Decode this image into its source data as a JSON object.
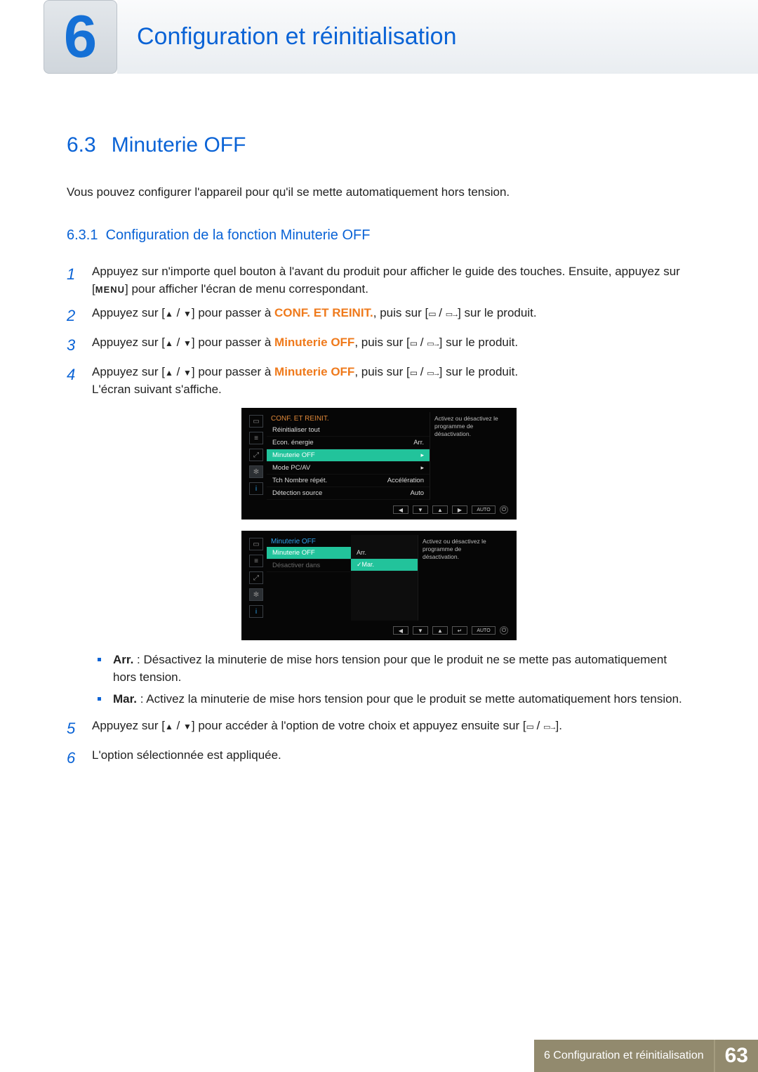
{
  "header": {
    "chapter_number": "6",
    "chapter_title": "Configuration et réinitialisation"
  },
  "section": {
    "number": "6.3",
    "title": "Minuterie OFF",
    "intro": "Vous pouvez configurer l'appareil pour qu'il se mette automatiquement hors tension."
  },
  "subsection": {
    "number": "6.3.1",
    "title": "Configuration de la fonction Minuterie OFF"
  },
  "steps": {
    "s1a": "Appuyez sur n'importe quel bouton à l'avant du produit pour afficher le guide des touches. Ensuite, appuyez sur [",
    "s1menu": "MENU",
    "s1b": "] pour afficher l'écran de menu correspondant.",
    "s2a": "Appuyez sur [",
    "s2b": "] pour passer à ",
    "s2hi": "CONF. ET REINIT.",
    "s2c": ", puis sur [",
    "s2d": "] sur le produit.",
    "s3a": "Appuyez sur [",
    "s3b": "] pour passer à ",
    "s3hi": "Minuterie OFF",
    "s3c": ", puis sur [",
    "s3d": "] sur le produit.",
    "s4a": "Appuyez sur [",
    "s4b": "] pour passer à ",
    "s4hi": "Minuterie OFF",
    "s4c": ", puis sur [",
    "s4d": "] sur le produit.",
    "s4e": "L'écran suivant s'affiche.",
    "s5a": "Appuyez sur [",
    "s5b": "] pour accéder à l'option de votre choix et appuyez ensuite sur [",
    "s5c": "].",
    "s6": "L'option sélectionnée est appliquée."
  },
  "osd1": {
    "title": "CONF. ET REINIT.",
    "rows": [
      {
        "label": "Réinitialiser tout",
        "value": ""
      },
      {
        "label": "Econ. énergie",
        "value": "Arr."
      },
      {
        "label": "Minuterie OFF",
        "value": "",
        "hi": true,
        "arrow": true
      },
      {
        "label": "Mode PC/AV",
        "value": "",
        "arrow": true
      },
      {
        "label": "Tch Nombre répét.",
        "value": "Accélération"
      },
      {
        "label": "Détection source",
        "value": "Auto"
      }
    ],
    "side": "Activez ou désactivez le programme de désactivation.",
    "nav_auto": "AUTO"
  },
  "osd2": {
    "title": "Minuterie OFF",
    "rows": [
      {
        "label": "Minuterie OFF",
        "hi": true
      },
      {
        "label": "Désactiver dans",
        "dim": true
      }
    ],
    "sub": [
      {
        "label": "Arr."
      },
      {
        "label": "Mar.",
        "hi": true
      }
    ],
    "side": "Activez ou désactivez le programme de désactivation.",
    "nav_auto": "AUTO"
  },
  "bullets": {
    "arr_label": "Arr.",
    "arr_text": " : Désactivez la minuterie de mise hors tension pour que le produit ne se mette pas automatiquement hors tension.",
    "mar_label": "Mar.",
    "mar_text": " : Activez la minuterie de mise hors tension pour que le produit se mette automatiquement hors tension."
  },
  "footer": {
    "text": "6 Configuration et réinitialisation",
    "page": "63"
  }
}
